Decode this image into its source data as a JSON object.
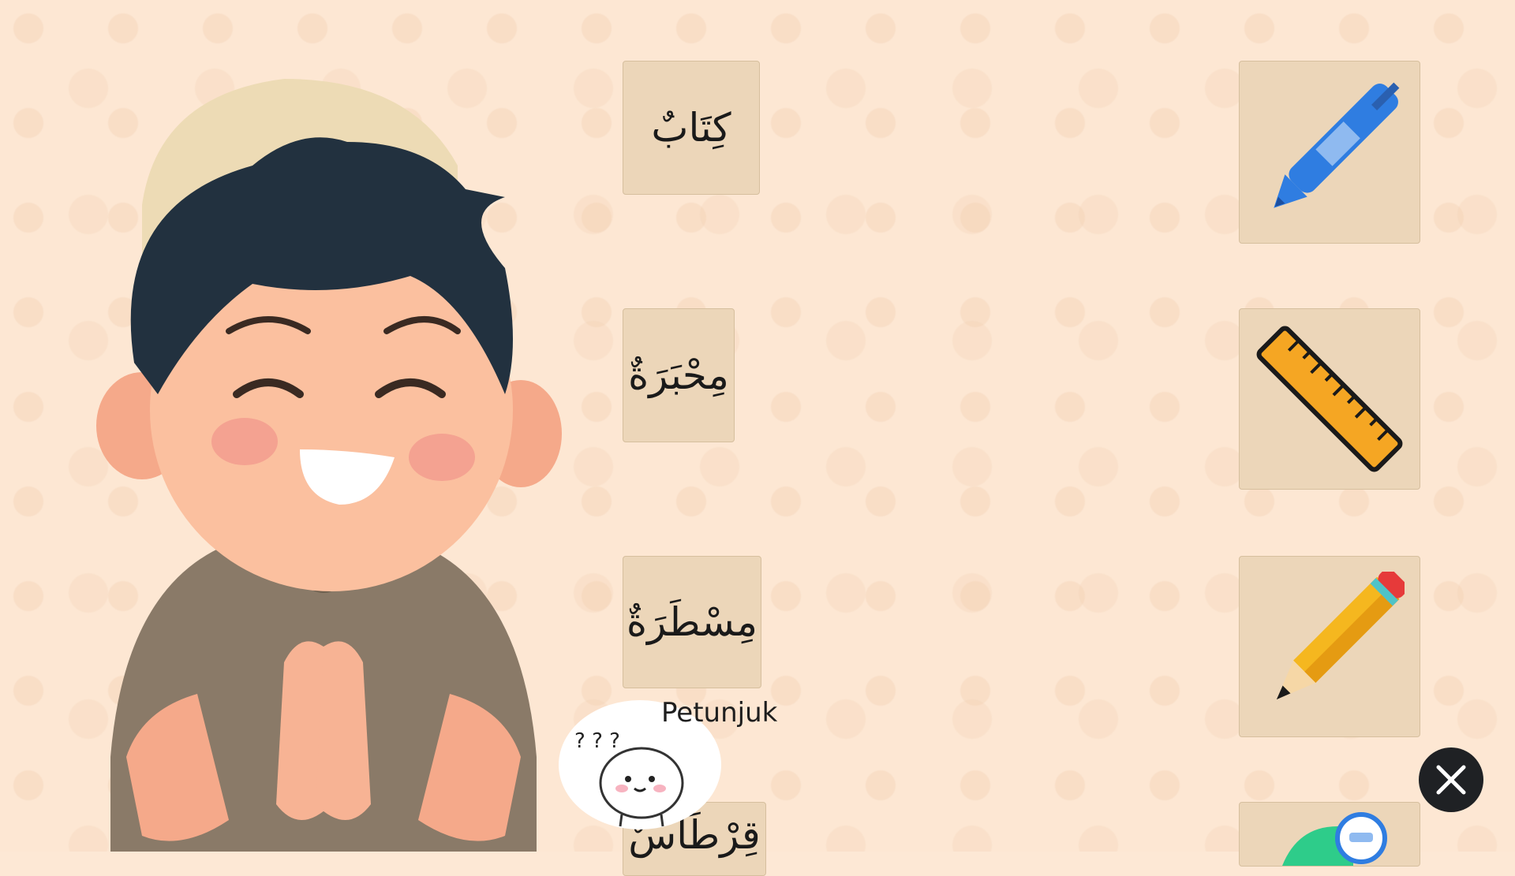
{
  "words": [
    {
      "text": "كِتَابٌ"
    },
    {
      "text": "مِحْبَرَةٌ"
    },
    {
      "text": "مِسْطَرَةٌ"
    },
    {
      "text": "قِرْطَاسٌ"
    }
  ],
  "pictures": [
    "pen-icon",
    "ruler-icon",
    "pencil-icon",
    "bag-icon"
  ],
  "hint": {
    "label": "Petunjuk",
    "marks": "? ? ?"
  },
  "colors": {
    "background": "#fde7d3",
    "card": "#ecd6b9",
    "close_button": "#1f2124"
  }
}
